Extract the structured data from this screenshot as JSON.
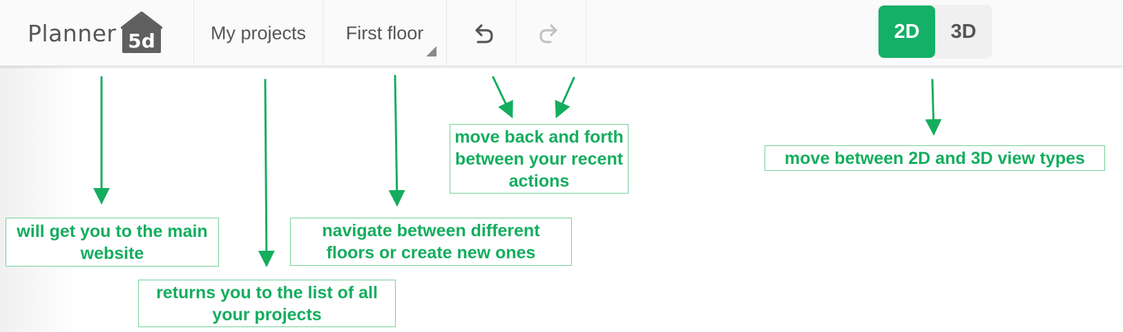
{
  "toolbar": {
    "logo_text": "Planner",
    "logo_badge": "5d",
    "my_projects_label": "My projects",
    "floor_label": "First floor",
    "undo_icon": "undo-icon",
    "redo_icon": "redo-icon",
    "view_2d_label": "2D",
    "view_3d_label": "3D",
    "active_view": "2D"
  },
  "annotations": {
    "logo_note": "will get you to the main website",
    "projects_note": "returns you to the list of all your projects",
    "floor_note": "navigate between different floors or create new ones",
    "history_note": "move back and forth between your recent actions",
    "view_note": "move between 2D and 3D view types"
  },
  "colors": {
    "accent": "#14b067",
    "annotation_text": "#14ad5e",
    "annotation_border": "#6fcf97",
    "toolbar_bg": "#fafafa",
    "text": "#555555",
    "redo_disabled": "#c2c2c2"
  }
}
